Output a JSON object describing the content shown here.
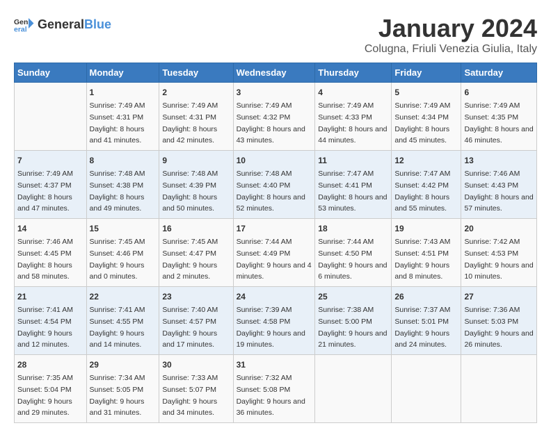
{
  "logo": {
    "general": "General",
    "blue": "Blue"
  },
  "header": {
    "title": "January 2024",
    "subtitle": "Colugna, Friuli Venezia Giulia, Italy"
  },
  "weekdays": [
    "Sunday",
    "Monday",
    "Tuesday",
    "Wednesday",
    "Thursday",
    "Friday",
    "Saturday"
  ],
  "weeks": [
    [
      {
        "day": "",
        "sunrise": "",
        "sunset": "",
        "daylight": ""
      },
      {
        "day": "1",
        "sunrise": "Sunrise: 7:49 AM",
        "sunset": "Sunset: 4:31 PM",
        "daylight": "Daylight: 8 hours and 41 minutes."
      },
      {
        "day": "2",
        "sunrise": "Sunrise: 7:49 AM",
        "sunset": "Sunset: 4:31 PM",
        "daylight": "Daylight: 8 hours and 42 minutes."
      },
      {
        "day": "3",
        "sunrise": "Sunrise: 7:49 AM",
        "sunset": "Sunset: 4:32 PM",
        "daylight": "Daylight: 8 hours and 43 minutes."
      },
      {
        "day": "4",
        "sunrise": "Sunrise: 7:49 AM",
        "sunset": "Sunset: 4:33 PM",
        "daylight": "Daylight: 8 hours and 44 minutes."
      },
      {
        "day": "5",
        "sunrise": "Sunrise: 7:49 AM",
        "sunset": "Sunset: 4:34 PM",
        "daylight": "Daylight: 8 hours and 45 minutes."
      },
      {
        "day": "6",
        "sunrise": "Sunrise: 7:49 AM",
        "sunset": "Sunset: 4:35 PM",
        "daylight": "Daylight: 8 hours and 46 minutes."
      }
    ],
    [
      {
        "day": "7",
        "sunrise": "Sunrise: 7:49 AM",
        "sunset": "Sunset: 4:37 PM",
        "daylight": "Daylight: 8 hours and 47 minutes."
      },
      {
        "day": "8",
        "sunrise": "Sunrise: 7:48 AM",
        "sunset": "Sunset: 4:38 PM",
        "daylight": "Daylight: 8 hours and 49 minutes."
      },
      {
        "day": "9",
        "sunrise": "Sunrise: 7:48 AM",
        "sunset": "Sunset: 4:39 PM",
        "daylight": "Daylight: 8 hours and 50 minutes."
      },
      {
        "day": "10",
        "sunrise": "Sunrise: 7:48 AM",
        "sunset": "Sunset: 4:40 PM",
        "daylight": "Daylight: 8 hours and 52 minutes."
      },
      {
        "day": "11",
        "sunrise": "Sunrise: 7:47 AM",
        "sunset": "Sunset: 4:41 PM",
        "daylight": "Daylight: 8 hours and 53 minutes."
      },
      {
        "day": "12",
        "sunrise": "Sunrise: 7:47 AM",
        "sunset": "Sunset: 4:42 PM",
        "daylight": "Daylight: 8 hours and 55 minutes."
      },
      {
        "day": "13",
        "sunrise": "Sunrise: 7:46 AM",
        "sunset": "Sunset: 4:43 PM",
        "daylight": "Daylight: 8 hours and 57 minutes."
      }
    ],
    [
      {
        "day": "14",
        "sunrise": "Sunrise: 7:46 AM",
        "sunset": "Sunset: 4:45 PM",
        "daylight": "Daylight: 8 hours and 58 minutes."
      },
      {
        "day": "15",
        "sunrise": "Sunrise: 7:45 AM",
        "sunset": "Sunset: 4:46 PM",
        "daylight": "Daylight: 9 hours and 0 minutes."
      },
      {
        "day": "16",
        "sunrise": "Sunrise: 7:45 AM",
        "sunset": "Sunset: 4:47 PM",
        "daylight": "Daylight: 9 hours and 2 minutes."
      },
      {
        "day": "17",
        "sunrise": "Sunrise: 7:44 AM",
        "sunset": "Sunset: 4:49 PM",
        "daylight": "Daylight: 9 hours and 4 minutes."
      },
      {
        "day": "18",
        "sunrise": "Sunrise: 7:44 AM",
        "sunset": "Sunset: 4:50 PM",
        "daylight": "Daylight: 9 hours and 6 minutes."
      },
      {
        "day": "19",
        "sunrise": "Sunrise: 7:43 AM",
        "sunset": "Sunset: 4:51 PM",
        "daylight": "Daylight: 9 hours and 8 minutes."
      },
      {
        "day": "20",
        "sunrise": "Sunrise: 7:42 AM",
        "sunset": "Sunset: 4:53 PM",
        "daylight": "Daylight: 9 hours and 10 minutes."
      }
    ],
    [
      {
        "day": "21",
        "sunrise": "Sunrise: 7:41 AM",
        "sunset": "Sunset: 4:54 PM",
        "daylight": "Daylight: 9 hours and 12 minutes."
      },
      {
        "day": "22",
        "sunrise": "Sunrise: 7:41 AM",
        "sunset": "Sunset: 4:55 PM",
        "daylight": "Daylight: 9 hours and 14 minutes."
      },
      {
        "day": "23",
        "sunrise": "Sunrise: 7:40 AM",
        "sunset": "Sunset: 4:57 PM",
        "daylight": "Daylight: 9 hours and 17 minutes."
      },
      {
        "day": "24",
        "sunrise": "Sunrise: 7:39 AM",
        "sunset": "Sunset: 4:58 PM",
        "daylight": "Daylight: 9 hours and 19 minutes."
      },
      {
        "day": "25",
        "sunrise": "Sunrise: 7:38 AM",
        "sunset": "Sunset: 5:00 PM",
        "daylight": "Daylight: 9 hours and 21 minutes."
      },
      {
        "day": "26",
        "sunrise": "Sunrise: 7:37 AM",
        "sunset": "Sunset: 5:01 PM",
        "daylight": "Daylight: 9 hours and 24 minutes."
      },
      {
        "day": "27",
        "sunrise": "Sunrise: 7:36 AM",
        "sunset": "Sunset: 5:03 PM",
        "daylight": "Daylight: 9 hours and 26 minutes."
      }
    ],
    [
      {
        "day": "28",
        "sunrise": "Sunrise: 7:35 AM",
        "sunset": "Sunset: 5:04 PM",
        "daylight": "Daylight: 9 hours and 29 minutes."
      },
      {
        "day": "29",
        "sunrise": "Sunrise: 7:34 AM",
        "sunset": "Sunset: 5:05 PM",
        "daylight": "Daylight: 9 hours and 31 minutes."
      },
      {
        "day": "30",
        "sunrise": "Sunrise: 7:33 AM",
        "sunset": "Sunset: 5:07 PM",
        "daylight": "Daylight: 9 hours and 34 minutes."
      },
      {
        "day": "31",
        "sunrise": "Sunrise: 7:32 AM",
        "sunset": "Sunset: 5:08 PM",
        "daylight": "Daylight: 9 hours and 36 minutes."
      },
      {
        "day": "",
        "sunrise": "",
        "sunset": "",
        "daylight": ""
      },
      {
        "day": "",
        "sunrise": "",
        "sunset": "",
        "daylight": ""
      },
      {
        "day": "",
        "sunrise": "",
        "sunset": "",
        "daylight": ""
      }
    ]
  ]
}
